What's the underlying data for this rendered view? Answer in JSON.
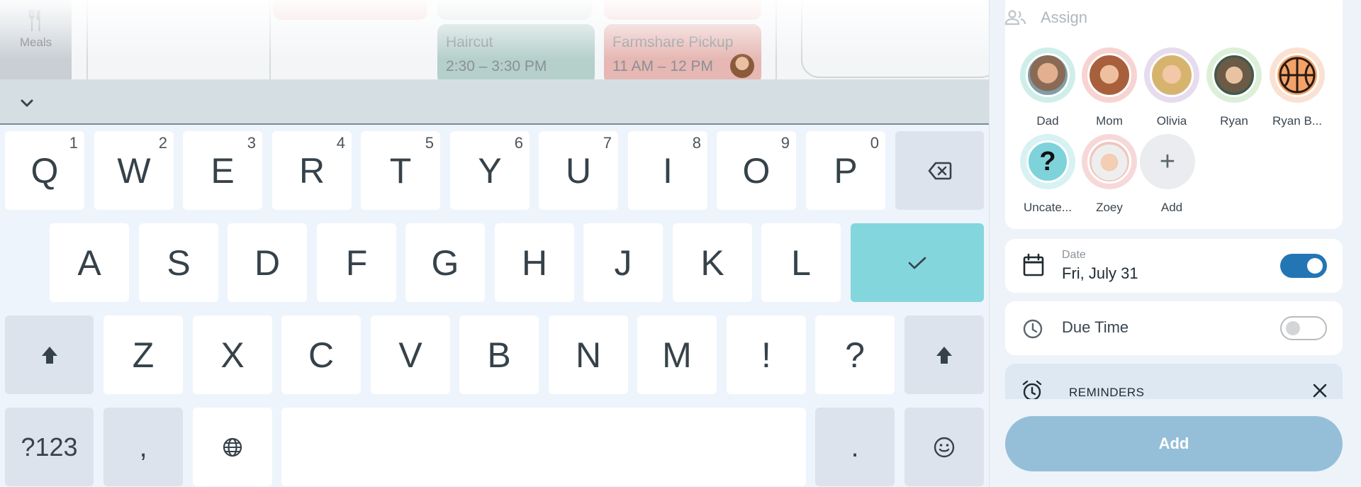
{
  "calendar": {
    "meals_label": "Meals",
    "events": [
      {
        "title": "Haircut",
        "time": "2:30 – 3:30 PM"
      },
      {
        "title": "Farmshare Pickup",
        "time": "11 AM – 12 PM"
      }
    ]
  },
  "keyboard": {
    "row1": [
      {
        "letter": "Q",
        "hint": "1"
      },
      {
        "letter": "W",
        "hint": "2"
      },
      {
        "letter": "E",
        "hint": "3"
      },
      {
        "letter": "R",
        "hint": "4"
      },
      {
        "letter": "T",
        "hint": "5"
      },
      {
        "letter": "Y",
        "hint": "6"
      },
      {
        "letter": "U",
        "hint": "7"
      },
      {
        "letter": "I",
        "hint": "8"
      },
      {
        "letter": "O",
        "hint": "9"
      },
      {
        "letter": "P",
        "hint": "0"
      }
    ],
    "row2": [
      "A",
      "S",
      "D",
      "F",
      "G",
      "H",
      "J",
      "K",
      "L"
    ],
    "row3": [
      "Z",
      "X",
      "C",
      "V",
      "B",
      "N",
      "M",
      "!",
      "?"
    ],
    "symbols_label": "?123",
    "comma_label": ",",
    "period_label": "."
  },
  "panel": {
    "assign_label": "Assign",
    "people": [
      {
        "name": "Dad"
      },
      {
        "name": "Mom"
      },
      {
        "name": "Olivia"
      },
      {
        "name": "Ryan"
      },
      {
        "name": "Ryan B..."
      },
      {
        "name": "Uncate..."
      },
      {
        "name": "Zoey"
      },
      {
        "name": "Add"
      }
    ],
    "date_label": "Date",
    "date_value": "Fri, July 31",
    "date_enabled": true,
    "due_time_label": "Due Time",
    "due_time_enabled": false,
    "reminders_label": "REMINDERS",
    "add_button": "Add"
  },
  "colors": {
    "accent": "#2376b4",
    "confirm_key": "#83d6dc",
    "add_button": "#95bfd8"
  }
}
